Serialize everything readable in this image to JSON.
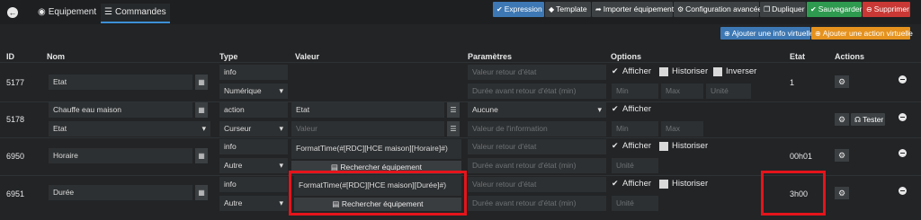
{
  "tabs": {
    "equipement": "Equipement",
    "commandes": "Commandes"
  },
  "toolbar": {
    "expression": "Expression",
    "template": "Template",
    "import": "Importer équipement",
    "config": "Configuration avancée",
    "duplicate": "Dupliquer",
    "save": "Sauvegarder",
    "delete": "Supprimer",
    "add_info": "Ajouter une info virtuelle",
    "add_action": "Ajouter une action virtuelle"
  },
  "headers": {
    "id": "ID",
    "nom": "Nom",
    "type": "Type",
    "valeur": "Valeur",
    "params": "Paramètres",
    "options": "Options",
    "etat": "Etat",
    "actions": "Actions"
  },
  "placeholders": {
    "retour": "Valeur retour d'état",
    "duree": "Durée avant retour d'état (min)",
    "min": "Min",
    "max": "Max",
    "unite": "Unité",
    "valeur": "Valeur",
    "info": "Valeur de l'information"
  },
  "option_labels": {
    "afficher": "Afficher",
    "historiser": "Historiser",
    "inverser": "Inverser"
  },
  "search_label": "Rechercher équipement",
  "tester_label": "Tester",
  "rows": [
    {
      "id": "5177",
      "nom": "Etat",
      "type": "info",
      "subtype": "Numérique",
      "etat": "1"
    },
    {
      "id": "5178",
      "nom": "Chauffe eau maison",
      "nom2": "Etat",
      "type": "action",
      "subtype": "Curseur",
      "valeur": "Etat",
      "param": "Aucune"
    },
    {
      "id": "6950",
      "nom": "Horaire",
      "type": "info",
      "subtype": "Autre",
      "valeur": "FormatTime(#[RDC][HCE maison][Horaire]#)",
      "etat": "00h01"
    },
    {
      "id": "6951",
      "nom": "Durée",
      "type": "info",
      "subtype": "Autre",
      "valeur": "FormatTime(#[RDC][HCE maison][Durée]#)",
      "etat": "3h00"
    }
  ]
}
